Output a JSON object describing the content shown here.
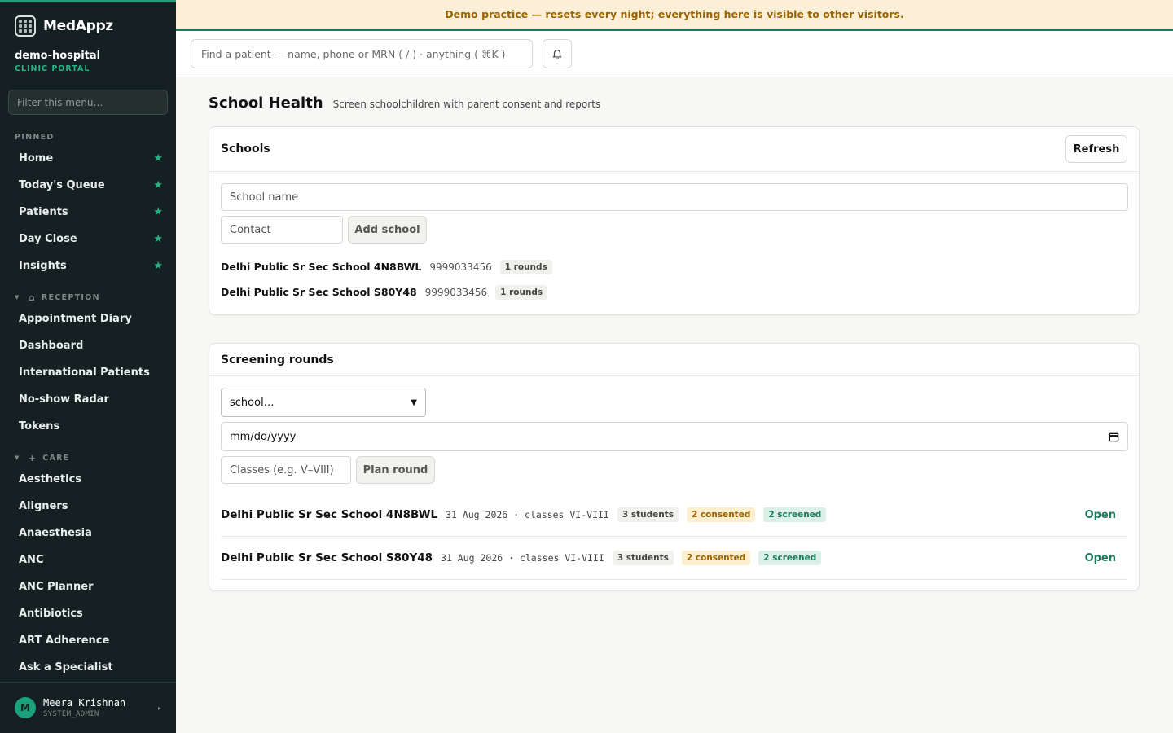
{
  "banner": "Demo practice — resets every night; everything here is visible to other visitors.",
  "brand": {
    "name": "MedAppz"
  },
  "tenant": {
    "name": "demo-hospital",
    "subtitle": "CLINIC PORTAL"
  },
  "sidebar": {
    "filter_placeholder": "Filter this menu…",
    "pinned_label": "PINNED",
    "pinned": [
      "Home",
      "Today's Queue",
      "Patients",
      "Day Close",
      "Insights"
    ],
    "reception_label": "RECEPTION",
    "reception": [
      "Appointment Diary",
      "Dashboard",
      "International Patients",
      "No-show Radar",
      "Tokens"
    ],
    "care_label": "CARE",
    "care": [
      "Aesthetics",
      "Aligners",
      "Anaesthesia",
      "ANC",
      "ANC Planner",
      "Antibiotics",
      "ART Adherence",
      "Ask a Specialist"
    ]
  },
  "user": {
    "initial": "M",
    "name": "Meera Krishnan",
    "role": "SYSTEM_ADMIN"
  },
  "search": {
    "placeholder": "Find a patient — name, phone or MRN ( / ) · anything ( ⌘K )"
  },
  "page": {
    "title": "School Health",
    "subtitle": "Screen schoolchildren with parent consent and reports"
  },
  "schools_card": {
    "title": "Schools",
    "refresh_label": "Refresh",
    "name_placeholder": "School name",
    "contact_placeholder": "Contact",
    "add_label": "Add school",
    "schools": [
      {
        "name": "Delhi Public Sr Sec School 4N8BWL",
        "phone": "9999033456",
        "rounds": "1 rounds"
      },
      {
        "name": "Delhi Public Sr Sec School S80Y48",
        "phone": "9999033456",
        "rounds": "1 rounds"
      }
    ]
  },
  "rounds_card": {
    "title": "Screening rounds",
    "school_select": "school…",
    "date_placeholder": "mm/dd/yyyy",
    "classes_placeholder": "Classes (e.g. V–VIII)",
    "plan_label": "Plan round",
    "rounds": [
      {
        "school": "Delhi Public Sr Sec School 4N8BWL",
        "meta": "31 Aug 2026 · classes VI-VIII",
        "students": "3 students",
        "consented": "2 consented",
        "screened": "2 screened",
        "action": "Open"
      },
      {
        "school": "Delhi Public Sr Sec School S80Y48",
        "meta": "31 Aug 2026 · classes VI-VIII",
        "students": "3 students",
        "consented": "2 consented",
        "screened": "2 screened",
        "action": "Open"
      }
    ]
  },
  "colors": {
    "accent": "#1aa37a",
    "sidebar_bg": "#152022",
    "banner_bg": "#fbf0d7",
    "banner_text": "#9a6200"
  }
}
